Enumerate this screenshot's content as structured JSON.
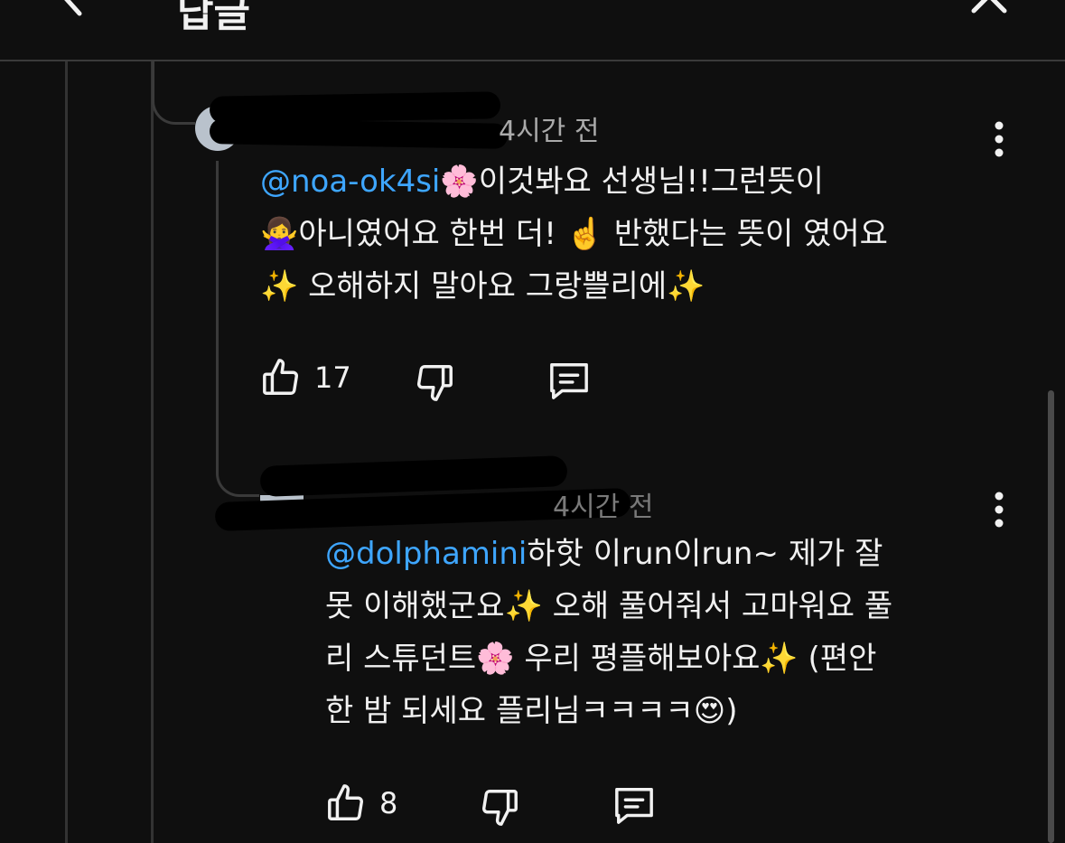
{
  "header": {
    "title": "답글",
    "back_icon": "chevron-left-icon",
    "close_icon": "close-icon"
  },
  "comments": [
    {
      "time": "4시간 전",
      "mention": "@noa-ok4si",
      "text_line1": "🌸이것봐요 선생님!!그런뜻이",
      "text_line2": "🙅‍♀️아니였어요 한번 더! ☝️ 반했다는 뜻이 였어요",
      "text_line3": "✨ 오해하지 말아요 그랑쁠리에✨",
      "likes": "17"
    },
    {
      "time": "4시간 전",
      "mention": "@dolphamini",
      "text_line1": "하핫 이run이run~ 제가 잘",
      "text_line2": "못 이해했군요✨ 오해 풀어줘서 고마워요 풀",
      "text_line3": "리 스튜던트🌸 우리 평플해보아요✨ (편안",
      "text_line4": "한 밤 되세요 플리님ㅋㅋㅋㅋ😍)",
      "likes": "8"
    }
  ],
  "icons": {
    "like": "thumbs-up-icon",
    "dislike": "thumbs-down-icon",
    "reply": "comment-icon",
    "more": "more-vertical-icon"
  },
  "colors": {
    "background": "#0f0f0f",
    "mention": "#3ea6ff",
    "text": "#f1f1f1",
    "meta": "#aaaaaa"
  }
}
